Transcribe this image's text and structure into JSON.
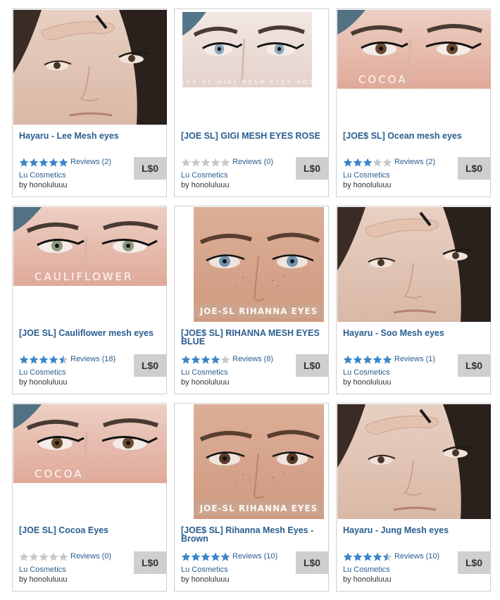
{
  "colors": {
    "link": "#2a5d8f",
    "star_on": "#3a86c8",
    "star_off": "#c8c8c8",
    "price_bg": "#cfcfcf"
  },
  "products": [
    {
      "title": "Hayaru - Lee Mesh eyes",
      "rating": 5,
      "reviews": "Reviews (2)",
      "store": "Lu Cosmetics",
      "author": "by honoluluuu",
      "price": "L$0",
      "watermark": ""
    },
    {
      "title": "[JOE SL] GIGI MESH EYES ROSE",
      "rating": 0,
      "reviews": "Reviews (0)",
      "store": "Lu Cosmetics",
      "author": "by honoluluuu",
      "price": "L$0",
      "watermark": "JOE SL GIGI MESH EYES ROSE"
    },
    {
      "title": "[JOE$ SL] Ocean mesh eyes",
      "rating": 3,
      "reviews": "Reviews (2)",
      "store": "Lu Cosmetics",
      "author": "by honoluluuu",
      "price": "L$0",
      "watermark": "COCOA"
    },
    {
      "title": "[JOE SL] Cauliflower mesh eyes",
      "rating": 4.5,
      "reviews": "Reviews (18)",
      "store": "Lu Cosmetics",
      "author": "by honoluluuu",
      "price": "L$0",
      "watermark": "CAULIFLOWER"
    },
    {
      "title": "[JOE$ SL] RIHANNA MESH EYES BLUE",
      "rating": 4,
      "reviews": "Reviews (8)",
      "store": "Lu Cosmetics",
      "author": "by honoluluuu",
      "price": "L$0",
      "watermark": "JOE-SL RIHANNA EYES"
    },
    {
      "title": "Hayaru - Soo Mesh eyes",
      "rating": 5,
      "reviews": "Reviews (1)",
      "store": "Lu Cosmetics",
      "author": "by honoluluuu",
      "price": "L$0",
      "watermark": ""
    },
    {
      "title": "[JOE SL] Cocoa Eyes",
      "rating": 0,
      "reviews": "Reviews (0)",
      "store": "Lu Cosmetics",
      "author": "by honoluluuu",
      "price": "L$0",
      "watermark": "COCOA"
    },
    {
      "title": "[JOE$ SL] Rihanna Mesh Eyes - Brown",
      "rating": 5,
      "reviews": "Reviews (10)",
      "store": "Lu Cosmetics",
      "author": "by honoluluuu",
      "price": "L$0",
      "watermark": "JOE-SL RIHANNA EYES"
    },
    {
      "title": "Hayaru - Jung Mesh eyes",
      "rating": 4.5,
      "reviews": "Reviews (10)",
      "store": "Lu Cosmetics",
      "author": "by honoluluuu",
      "price": "L$0",
      "watermark": ""
    }
  ]
}
